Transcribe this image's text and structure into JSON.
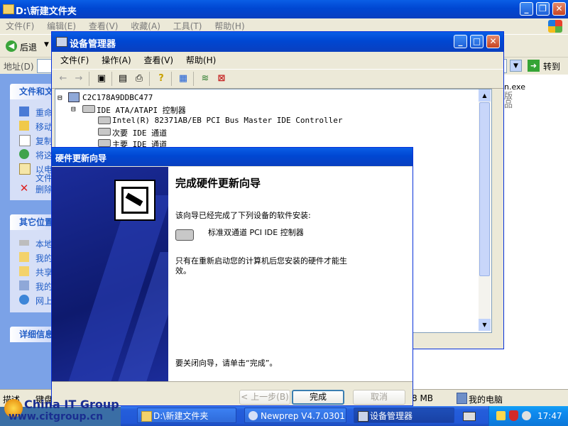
{
  "explorer": {
    "title": "D:\\新建文件夹",
    "menu": [
      "文件(F)",
      "编辑(E)",
      "查看(V)",
      "收藏(A)",
      "工具(T)",
      "帮助(H)"
    ],
    "back_label": "后退",
    "address_label": "地址(D)",
    "go_label": "转到",
    "file_tasks_header": "文件和文",
    "file_tasks": [
      "重命",
      "移动",
      "复制",
      "将这",
      "以电",
      "文件",
      "删除"
    ],
    "other_places_header": "其它位置",
    "other_places": [
      "本地",
      "我的",
      "共享",
      "我的",
      "网上"
    ],
    "details_header": "详细信息",
    "right_fragments": [
      "n.exe",
      "版",
      "品"
    ],
    "status_left": "描述",
    "status_mid": "键盘",
    "status_size": "8 MB",
    "status_computer": "我的电脑"
  },
  "devmgr": {
    "title": "设备管理器",
    "menu": [
      "文件(F)",
      "操作(A)",
      "查看(V)",
      "帮助(H)"
    ],
    "tree": [
      {
        "label": "C2C178A9DDBC477"
      },
      {
        "label": "IDE ATA/ATAPI 控制器"
      },
      {
        "label": "Intel(R) 82371AB/EB PCI Bus Master IDE Controller"
      },
      {
        "label": "次要 IDE 通道"
      },
      {
        "label": "主要 IDE 通道"
      }
    ]
  },
  "wizard": {
    "title": "硬件更新向导",
    "heading": "完成硬件更新向导",
    "intro": "该向导已经完成了下列设备的软件安装:",
    "device": "标准双通道 PCI IDE 控制器",
    "note_line1": "只有在重新启动您的计算机后您安装的硬件才能生",
    "note_line2": "效。",
    "close_hint": "要关闭向导，请单击“完成”。",
    "back_button": "< 上一步(B)",
    "finish_button": "完成",
    "cancel_button": "取消"
  },
  "taskbar": {
    "items": [
      "D:\\新建文件夹",
      "Newprep V4.7.0301",
      "设备管理器"
    ],
    "clock": "17:47"
  },
  "watermark": {
    "line1": "China IT Group",
    "line2": "www.citgroup.cn"
  },
  "colors": {
    "xp_blue": "#0a5ee6",
    "taskbar": "#245edb",
    "tray": "#0f8bf0",
    "start_green": "#3c9d3c",
    "link_blue": "#215dc6",
    "wizard_side": "#1a2a8c"
  }
}
